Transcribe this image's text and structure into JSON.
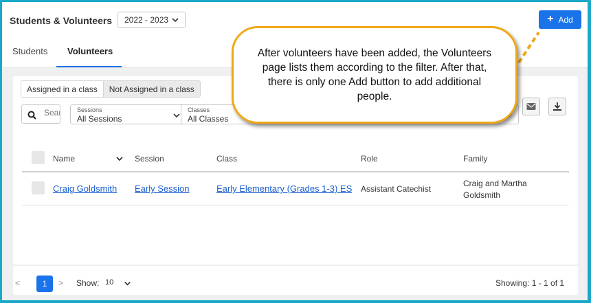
{
  "header": {
    "title": "Students & Volunteers",
    "year": "2022 - 2023",
    "add_label": "Add",
    "add_icon": "plus-icon"
  },
  "tabs": [
    {
      "label": "Students"
    },
    {
      "label": "Volunteers"
    }
  ],
  "toggle": {
    "options": [
      "Assigned in a class",
      "Not Assigned in a class"
    ],
    "selected": "Assigned in a class"
  },
  "search": {
    "placeholder": "Search"
  },
  "filters": {
    "sessions": {
      "label": "Sessions",
      "value": "All Sessions"
    },
    "classes": {
      "label": "Classes",
      "value": "All Classes"
    }
  },
  "actions": {
    "email_icon": "email-icon",
    "download_icon": "download-icon"
  },
  "table": {
    "columns": [
      "Name",
      "Session",
      "Class",
      "Role",
      "Family"
    ],
    "rows": [
      {
        "name": "Craig Goldsmith",
        "session": "Early Session",
        "class": "Early Elementary (Grades 1-3) ES",
        "role": "Assistant Catechist",
        "family": "Craig and Martha Goldsmith"
      }
    ]
  },
  "pager": {
    "prev": "<",
    "page": "1",
    "next": ">",
    "show_label": "Show:",
    "show_value": "10",
    "showing": "Showing: 1 - 1 of 1"
  },
  "callout": {
    "text": "After volunteers have been added, the Volunteers page lists them according to the filter. After that, there is only one Add button  to add additional people."
  },
  "colors": {
    "accent": "#1a73e8",
    "link": "#1a5fd0",
    "callout_border": "#f0a818",
    "frame": "#1aa8c8"
  }
}
